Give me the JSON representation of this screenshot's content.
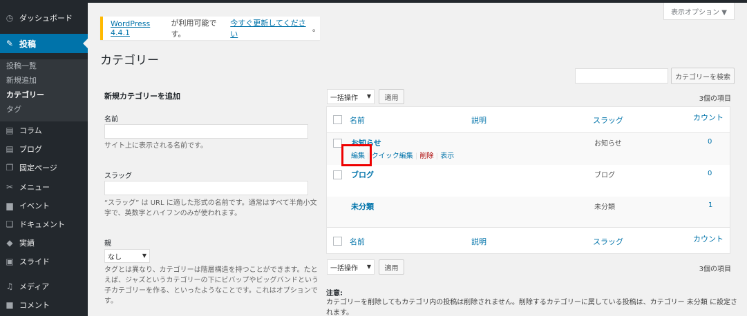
{
  "sidebar": {
    "items": [
      {
        "icon": "dashboard-icon",
        "glyph": "◷",
        "label": "ダッシュボード"
      },
      {
        "icon": "pin-icon",
        "glyph": "✎",
        "label": "投稿"
      },
      {
        "icon": "column-icon",
        "glyph": "▤",
        "label": "コラム"
      },
      {
        "icon": "blog-icon",
        "glyph": "▤",
        "label": "ブログ"
      },
      {
        "icon": "page-icon",
        "glyph": "❐",
        "label": "固定ページ"
      },
      {
        "icon": "menu-icon",
        "glyph": "✂",
        "label": "メニュー"
      },
      {
        "icon": "event-icon",
        "glyph": "▆",
        "label": "イベント"
      },
      {
        "icon": "document-icon",
        "glyph": "❑",
        "label": "ドキュメント"
      },
      {
        "icon": "results-icon",
        "glyph": "◆",
        "label": "実績"
      },
      {
        "icon": "slide-icon",
        "glyph": "▣",
        "label": "スライド"
      },
      {
        "icon": "media-icon",
        "glyph": "♫",
        "label": "メディア"
      },
      {
        "icon": "comment-icon",
        "glyph": "■",
        "label": "コメント"
      }
    ],
    "submenu": [
      "投稿一覧",
      "新規追加",
      "カテゴリー",
      "タグ"
    ]
  },
  "notice": {
    "version_link": "WordPress 4.4.1",
    "text": " が利用可能です。",
    "update_link": "今すぐ更新してください",
    "end": "。"
  },
  "screen_options": "表示オプション ▼",
  "page_title": "カテゴリー",
  "search": {
    "button": "カテゴリーを検索"
  },
  "form": {
    "title": "新規カテゴリーを追加",
    "name_label": "名前",
    "name_hint": "サイト上に表示される名前です。",
    "slug_label": "スラッグ",
    "slug_hint": "“スラッグ” は URL に適した形式の名前です。通常はすべて半角小文字で、英数字とハイフンのみが使われます。",
    "parent_label": "親",
    "parent_value": "なし",
    "parent_hint": "タグとは異なり、カテゴリーは階層構造を持つことができます。たとえば、ジャズというカテゴリーの下にビバップやビッグバンドという子カテゴリーを作る、といったようなことです。これはオプションです。"
  },
  "table": {
    "bulk_label": "一括操作",
    "apply_label": "適用",
    "count_label": "3個の項目",
    "headers": {
      "name": "名前",
      "description": "説明",
      "slug": "スラッグ",
      "count": "カウント"
    },
    "rows": [
      {
        "name": "お知らせ",
        "slug": "お知らせ",
        "count": "0"
      },
      {
        "name": "ブログ",
        "slug": "ブログ",
        "count": "0"
      },
      {
        "name": "未分類",
        "slug": "未分類",
        "count": "1"
      }
    ],
    "row_actions": {
      "edit": "編集",
      "quick_edit": "クイック編集",
      "delete": "削除",
      "view": "表示"
    }
  },
  "note": {
    "title": "注意:",
    "text": "カテゴリーを削除してもカテゴリ内の投稿は削除されません。削除するカテゴリーに属している投稿は、カテゴリー 未分類 に設定されます。"
  },
  "colors": {
    "accent": "#0073aa",
    "sidebar": "#23282d",
    "highlight": "#e00000",
    "notice": "#ffb900"
  }
}
